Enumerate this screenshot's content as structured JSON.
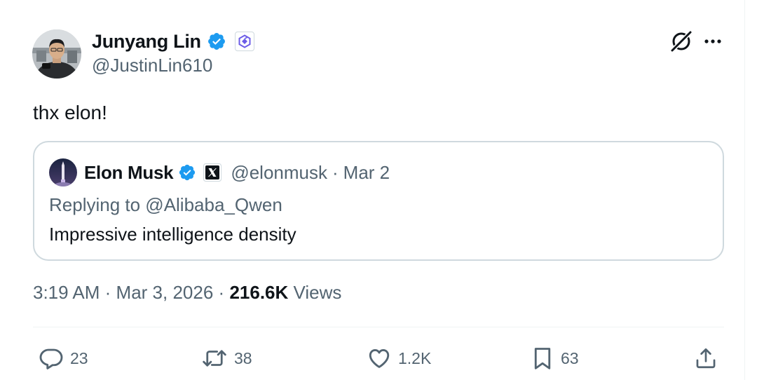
{
  "tweet": {
    "author": {
      "name": "Junyang Lin",
      "handle": "@JustinLin610",
      "verified": true,
      "affiliate_badge_icon": "qwen-logo-icon"
    },
    "text": "thx elon!",
    "header_icons": [
      "grok-icon",
      "more-icon"
    ],
    "quote": {
      "author_name": "Elon Musk",
      "handle": "@elonmusk",
      "separator": "·",
      "date": "Mar 2",
      "replying_to": "Replying to @Alibaba_Qwen",
      "text": "Impressive intelligence density",
      "affiliate_badge_icon": "x-logo-icon"
    },
    "meta": {
      "time": "3:19 AM",
      "separator": "·",
      "date": "Mar 3, 2026",
      "views_count": "216.6K",
      "views_label": "Views"
    },
    "actions": {
      "replies": "23",
      "reposts": "38",
      "likes": "1.2K",
      "bookmarks": "63"
    }
  },
  "colors": {
    "text_primary": "#0f1419",
    "text_secondary": "#536471",
    "verified_blue": "#1d9bf0",
    "border": "#cfd9de",
    "divider": "#eff3f4"
  }
}
